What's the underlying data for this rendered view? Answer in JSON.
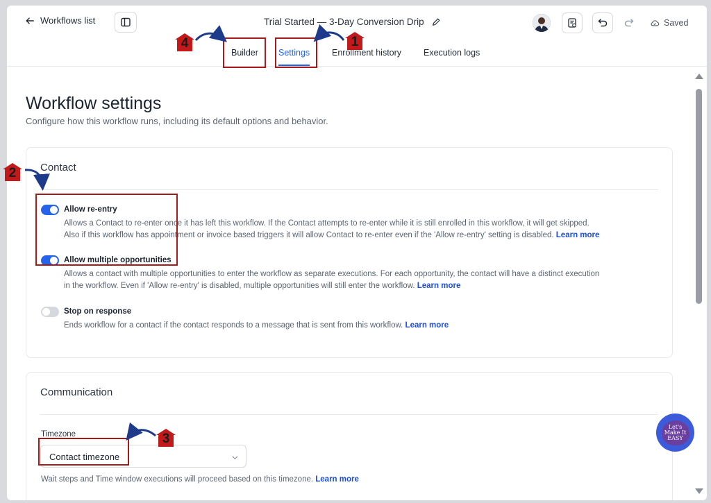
{
  "header": {
    "back_label": "Workflows list",
    "workflow_title": "Trial Started — 3-Day Conversion Drip",
    "status": "Saved"
  },
  "tabs": [
    {
      "label": "Builder",
      "active": false
    },
    {
      "label": "Settings",
      "active": true
    },
    {
      "label": "Enrollment history",
      "active": false
    },
    {
      "label": "Execution logs",
      "active": false
    }
  ],
  "page": {
    "title": "Workflow settings",
    "subtitle": "Configure how this workflow runs, including its default options and behavior."
  },
  "contact": {
    "title": "Contact",
    "options": [
      {
        "label": "Allow re-entry",
        "enabled": true,
        "desc_line1": "Allows a Contact to re-enter once it has left this workflow. If the Contact attempts to re-enter while it is still enrolled in this workflow, it will get skipped.",
        "desc_line2": "Also if this workflow has appointment or invoice based triggers it will allow Contact to re-enter even if the 'Allow re-entry' setting is disabled.",
        "learn_more": "Learn more"
      },
      {
        "label": "Allow multiple opportunities",
        "enabled": true,
        "desc_line1": "Allows a contact with multiple opportunities to enter the workflow as separate executions. For each opportunity, the contact will have a distinct execution",
        "desc_line2": "in the workflow. Even if 'Allow re-entry' is disabled, multiple opportunities will still enter the workflow.",
        "learn_more": "Learn more"
      },
      {
        "label": "Stop on response",
        "enabled": false,
        "desc_line1": "Ends workflow for a contact if the contact responds to a message that is sent from this workflow.",
        "learn_more": "Learn more"
      }
    ]
  },
  "communication": {
    "title": "Communication",
    "timezone_label": "Timezone",
    "timezone_value": "Contact timezone",
    "timezone_help": "Wait steps and Time window executions will proceed based on this timezone.",
    "learn_more": "Learn more"
  },
  "annotations": [
    "1",
    "2",
    "3",
    "4"
  ],
  "watermark": "Let's Make It EASY",
  "colors": {
    "accent": "#2563eb",
    "highlight": "#a31b1b",
    "annotation": "#c21a1a",
    "arrow": "#1e3a8a"
  }
}
